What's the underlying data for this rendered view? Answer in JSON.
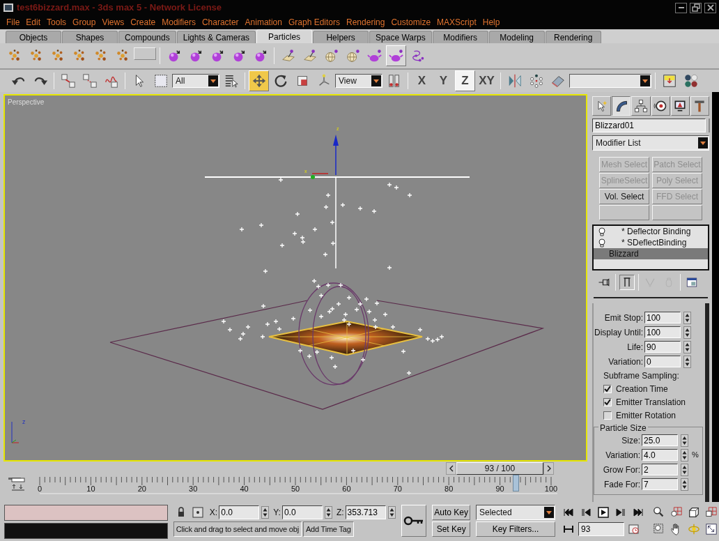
{
  "window": {
    "title": "test6bizzard.max - 3ds max 5 - Network License"
  },
  "menu": [
    "File",
    "Edit",
    "Tools",
    "Group",
    "Views",
    "Create",
    "Modifiers",
    "Character",
    "Animation",
    "Graph Editors",
    "Rendering",
    "Customize",
    "MAXScript",
    "Help"
  ],
  "tabs": [
    {
      "label": "Objects",
      "selected": false
    },
    {
      "label": "Shapes",
      "selected": false
    },
    {
      "label": "Compounds",
      "selected": false
    },
    {
      "label": "Lights & Cameras",
      "selected": false
    },
    {
      "label": "Particles",
      "selected": true
    },
    {
      "label": "Helpers",
      "selected": false
    },
    {
      "label": "Space Warps",
      "selected": false
    },
    {
      "label": "Modifiers",
      "selected": false
    },
    {
      "label": "Modeling",
      "selected": false
    },
    {
      "label": "Rendering",
      "selected": false
    }
  ],
  "create_toolbar": [
    {
      "buttons": [
        {
          "kind": "particles",
          "selected": false
        },
        {
          "kind": "particles",
          "selected": false
        },
        {
          "kind": "particles",
          "selected": false
        },
        {
          "kind": "particles",
          "selected": false
        },
        {
          "kind": "particles",
          "selected": false
        },
        {
          "kind": "particles",
          "selected": false
        },
        {
          "kind": "blank",
          "selected": false
        }
      ]
    },
    {
      "buttons": [
        {
          "kind": "sphere",
          "selected": false
        },
        {
          "kind": "sphere",
          "selected": false
        },
        {
          "kind": "sphere",
          "selected": false
        },
        {
          "kind": "sphere",
          "selected": false
        },
        {
          "kind": "sphere",
          "selected": false
        }
      ]
    },
    {
      "buttons": [
        {
          "kind": "pad",
          "selected": false
        },
        {
          "kind": "pad",
          "selected": false
        },
        {
          "kind": "globe",
          "selected": false
        },
        {
          "kind": "globe",
          "selected": false
        },
        {
          "kind": "teapot",
          "selected": false
        },
        {
          "kind": "teapot",
          "selected": true
        },
        {
          "kind": "beads",
          "selected": false
        }
      ]
    }
  ],
  "main_toolbar": [
    {
      "items": [
        {
          "kind": "undo",
          "selected": false
        },
        {
          "kind": "redo",
          "selected": false
        }
      ]
    },
    {
      "items": [
        {
          "kind": "link",
          "selected": false
        },
        {
          "kind": "unlink",
          "selected": false
        },
        {
          "kind": "bind",
          "selected": false
        }
      ]
    },
    {
      "items": [
        {
          "kind": "select",
          "selected": false
        },
        {
          "kind": "region",
          "selected": false
        },
        {
          "kind": "dropdown",
          "value": "All"
        },
        {
          "kind": "select-name",
          "selected": false
        }
      ]
    },
    {
      "items": [
        {
          "kind": "move",
          "selected": true
        },
        {
          "kind": "rotate",
          "selected": false
        },
        {
          "kind": "scale",
          "selected": false
        },
        {
          "kind": "pivot",
          "selected": false
        },
        {
          "kind": "dropdown",
          "value": "View"
        },
        {
          "kind": "center",
          "selected": false
        }
      ]
    },
    {
      "items": [
        {
          "kind": "axis",
          "label": "X",
          "selected": false
        },
        {
          "kind": "axis",
          "label": "Y",
          "selected": false
        },
        {
          "kind": "axis",
          "label": "Z",
          "selected": true
        },
        {
          "kind": "axis",
          "label": "XY",
          "selected": false
        }
      ]
    },
    {
      "items": [
        {
          "kind": "mirror",
          "selected": false
        },
        {
          "kind": "array",
          "selected": false
        },
        {
          "kind": "eraser",
          "selected": false
        },
        {
          "kind": "wide-dropdown"
        }
      ]
    },
    {
      "items": [
        {
          "kind": "track",
          "selected": false
        },
        {
          "kind": "material",
          "selected": false
        }
      ]
    }
  ],
  "viewport": {
    "label": "Perspective",
    "active": true,
    "gizmo_axes": [
      "z",
      "x"
    ],
    "tripod_axis": "z"
  },
  "command_panel": {
    "tabs": [
      {
        "kind": "create",
        "selected": false
      },
      {
        "kind": "modify",
        "selected": true
      },
      {
        "kind": "hierarchy",
        "selected": false
      },
      {
        "kind": "motion",
        "selected": false
      },
      {
        "kind": "display",
        "selected": false
      },
      {
        "kind": "utilities",
        "selected": false
      }
    ],
    "object_name": "Blizzard01",
    "modifier_list": "Modifier List",
    "modifier_sets": [
      {
        "kind": "button",
        "label": "Mesh Select",
        "disabled": true
      },
      {
        "kind": "button",
        "label": "Patch Select",
        "disabled": true
      },
      {
        "kind": "button",
        "label": "SplineSelect",
        "disabled": true
      },
      {
        "kind": "button",
        "label": "Poly Select",
        "disabled": true
      },
      {
        "kind": "button",
        "label": "Vol. Select",
        "disabled": false
      },
      {
        "kind": "button",
        "label": "FFD Select",
        "disabled": true
      },
      {
        "kind": "blank"
      },
      {
        "kind": "blank"
      }
    ],
    "stack": [
      {
        "kind": "binding",
        "label": "* Deflector Binding",
        "selected": false
      },
      {
        "kind": "binding",
        "label": "* SDeflectBinding",
        "selected": false
      },
      {
        "kind": "base",
        "label": "Blizzard",
        "selected": true
      }
    ],
    "stack_tools": [
      {
        "kind": "pin",
        "selected": false,
        "disabled": false
      },
      {
        "kind": "end-result",
        "selected": true,
        "disabled": false
      },
      {
        "kind": "unique",
        "selected": false,
        "disabled": true
      },
      {
        "kind": "remove",
        "selected": false,
        "disabled": true
      },
      {
        "kind": "configure",
        "selected": false,
        "disabled": false
      }
    ],
    "rollout": {
      "fields": [
        {
          "label": "Emit Stop:",
          "value": "100"
        },
        {
          "label": "Display Until:",
          "value": "100"
        },
        {
          "label": "Life:",
          "value": "90"
        },
        {
          "label": "Variation:",
          "value": "0"
        }
      ],
      "subframe_label": "Subframe Sampling:",
      "checks": [
        {
          "label": "Creation Time",
          "checked": true
        },
        {
          "label": "Emitter Translation",
          "checked": true
        },
        {
          "label": "Emitter Rotation",
          "checked": false
        }
      ],
      "particle_size": {
        "title": "Particle Size",
        "fields": [
          {
            "label": "Size:",
            "value": "25.0"
          },
          {
            "label": "Variation:",
            "value": "4.0",
            "unit": "%"
          },
          {
            "label": "Grow For:",
            "value": "2"
          },
          {
            "label": "Fade For:",
            "value": "7"
          }
        ]
      }
    }
  },
  "timeline": {
    "frame": "93 / 100",
    "ticks": [
      "0",
      "10",
      "20",
      "30",
      "40",
      "50",
      "60",
      "70",
      "80",
      "90",
      "100"
    ]
  },
  "status": {
    "coords": [
      {
        "label": "X:",
        "value": "0.0"
      },
      {
        "label": "Y:",
        "value": "0.0"
      },
      {
        "label": "Z:",
        "value": "353.713"
      }
    ],
    "prompt": "Click and drag to select and move obj",
    "time_tag": "Add Time Tag"
  },
  "animation": {
    "auto_key": {
      "label": "Auto Key",
      "on": false
    },
    "set_key": "Set Key",
    "key_mode": "Selected",
    "key_filters": "Key Filters...",
    "frame": "93"
  }
}
